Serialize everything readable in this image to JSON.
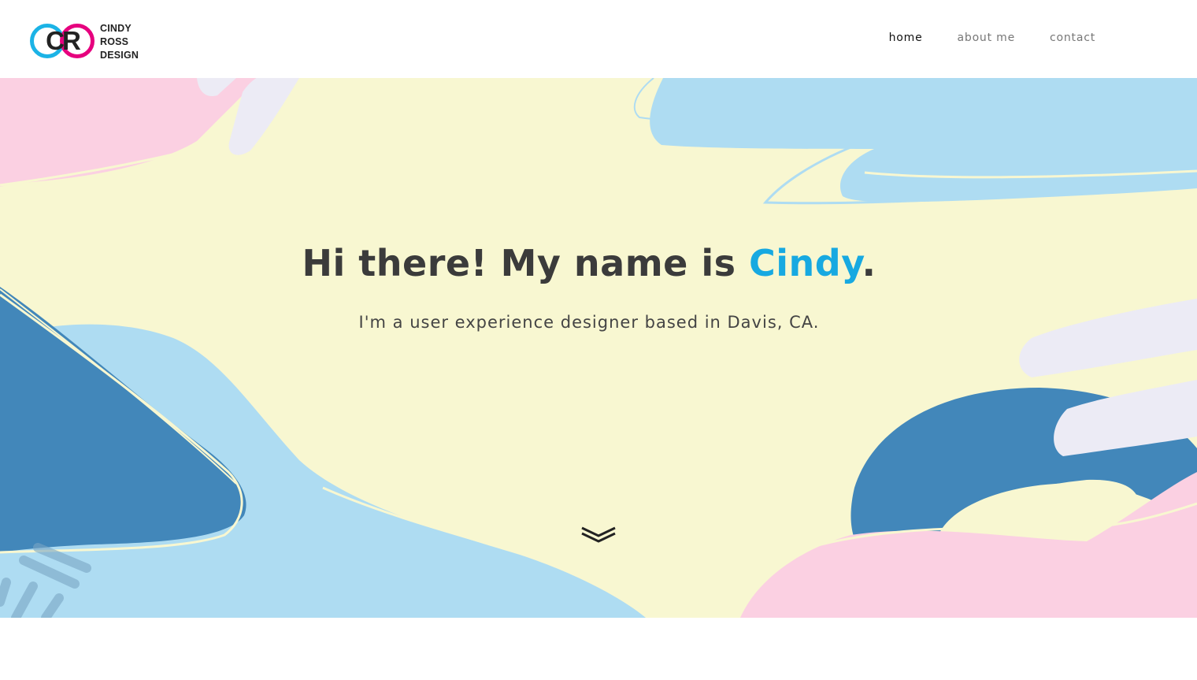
{
  "brand": {
    "logo_monogram": "CR",
    "logo_lines": [
      "CINDY",
      "ROSS",
      "DESIGN"
    ]
  },
  "nav": {
    "items": [
      {
        "label": "home",
        "active": true
      },
      {
        "label": "about me",
        "active": false
      },
      {
        "label": "contact",
        "active": false
      }
    ]
  },
  "hero": {
    "title_prefix": "Hi there! My name is ",
    "title_name": "Cindy",
    "title_suffix": ".",
    "subtitle": "I'm a user experience designer based in Davis, CA.",
    "scroll_icon": "double-chevron-down-icon"
  },
  "colors": {
    "accent_blue": "#17a9e1",
    "brand_magenta": "#e6007e",
    "hero_yellow": "#f8f7d1",
    "shape_light_blue": "#aedcf2",
    "shape_dark_blue": "#4287ba",
    "shape_pink": "#fbd0e2",
    "shape_lavender": "#ecebf5"
  }
}
